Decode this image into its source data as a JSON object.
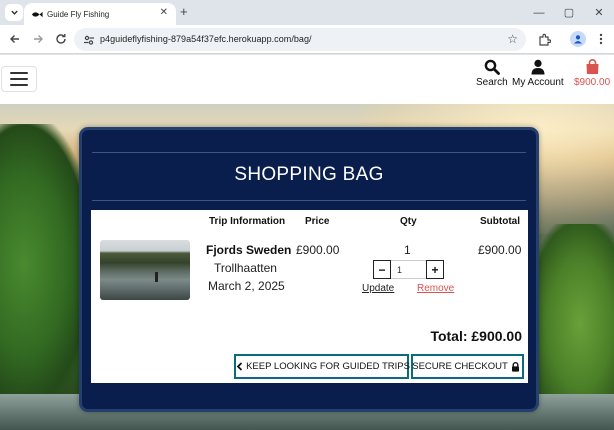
{
  "browser": {
    "tab_title": "Guide Fly Fishing",
    "url": "p4guideflyfishing-879a54f37efc.herokuapp.com/bag/",
    "new_tab_label": "+",
    "tab_close_label": "✕",
    "window_controls": [
      "—",
      "▢",
      "✕"
    ]
  },
  "header": {
    "search_label": "Search",
    "account_label": "My Account",
    "bag_total": "$900.00",
    "accent_color": "#d9534f"
  },
  "bag": {
    "title": "SHOPPING BAG",
    "columns": {
      "trip_info": "Trip Information",
      "price": "Price",
      "qty": "Qty",
      "subtotal": "Subtotal"
    },
    "item": {
      "name": "Fjords Sweden",
      "location": "Trollhaatten",
      "date": "March 2, 2025",
      "price": "£900.00",
      "qty": "1",
      "qty_input": "1",
      "subtotal": "£900.00",
      "decrement_label": "−",
      "increment_label": "+",
      "update_label": "Update",
      "remove_label": "Remove"
    },
    "total": "Total: £900.00",
    "keep_looking_label": "KEEP LOOKING FOR GUIDED TRIPS",
    "checkout_label": "SECURE CHECKOUT"
  },
  "icons": {
    "hamburger": "hamburger-icon",
    "search": "search-icon",
    "account": "user-icon",
    "bag": "shopping-bag-icon",
    "lock": "lock-icon",
    "chevron_left": "chevron-left-icon"
  },
  "colors": {
    "panel_bg": "#0a1e4e",
    "button_border": "#0a6b7a"
  }
}
